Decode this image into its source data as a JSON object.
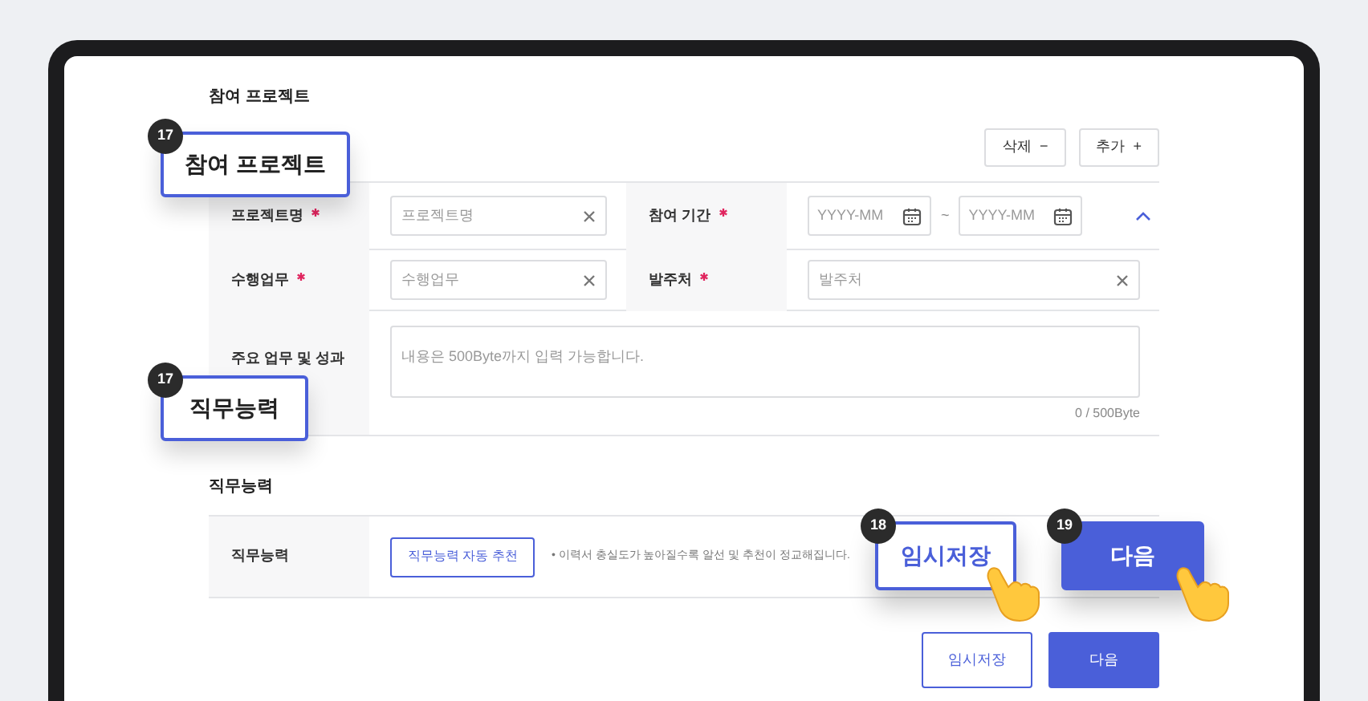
{
  "project_section": {
    "heading": "참여 프로젝트",
    "buttons": [
      {
        "label": "삭제",
        "symbol": "−"
      },
      {
        "label": "추가",
        "symbol": "+"
      }
    ]
  },
  "project_form": {
    "name": {
      "label": "프로젝트명",
      "required": true,
      "placeholder": "프로젝트명"
    },
    "period": {
      "label": "참여 기간",
      "required": true,
      "start_placeholder": "YYYY-MM",
      "separator": "~",
      "end_placeholder": "YYYY-MM",
      "expanded": true
    },
    "duty": {
      "label": "수행업무",
      "required": true,
      "placeholder": "수행업무"
    },
    "client": {
      "label": "발주처",
      "required": true,
      "placeholder": "발주처"
    },
    "achievements": {
      "label": "주요 업무 및 성과",
      "placeholder": "내용은 500Byte까지 입력 가능합니다.",
      "counter": "0 / 500Byte"
    }
  },
  "skills_section": {
    "heading": "직무능력",
    "row_label": "직무능력",
    "auto_button": "직무능력 자동 추천",
    "note": "• 이력서 충실도가 높아질수록 알선 및 추천이 정교해집니다."
  },
  "footer_buttons": [
    {
      "label": "임시저장",
      "kind": "outline"
    },
    {
      "label": "다음",
      "kind": "filled"
    }
  ],
  "callouts": [
    {
      "number": "17",
      "label": "참여 프로젝트",
      "kind": "outline",
      "pointer": false
    },
    {
      "number": "17",
      "label": "직무능력",
      "kind": "outline",
      "pointer": false
    },
    {
      "number": "18",
      "label": "임시저장",
      "kind": "outline-blue",
      "pointer": true
    },
    {
      "number": "19",
      "label": "다음",
      "kind": "filled",
      "pointer": true
    }
  ]
}
